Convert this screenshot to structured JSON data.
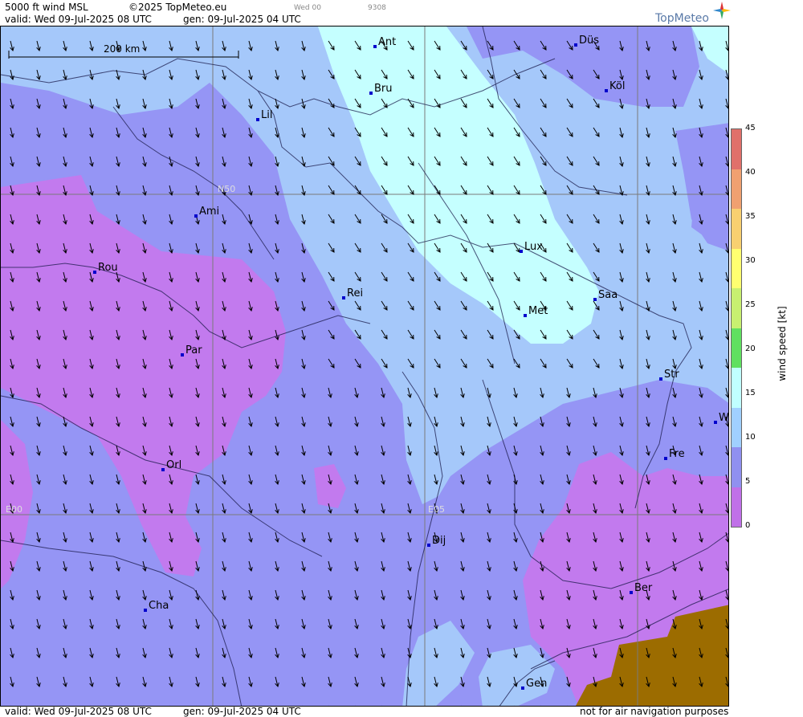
{
  "header": {
    "product": "5000 ft wind MSL",
    "copyright": "©2025 TopMeteo.eu",
    "small_a": "Wed 00",
    "small_b": "9308",
    "valid": "valid:  Wed  09-Jul-2025  08 UTC",
    "gen": "gen: 09-Jul-2025 04 UTC",
    "brand": "TopMeteo"
  },
  "footer": {
    "valid": "valid:  Wed  09-Jul-2025  08 UTC",
    "gen": "gen: 09-Jul-2025 04 UTC",
    "disclaimer": "not for air navigation purposes"
  },
  "map": {
    "scale_label": "200 km",
    "grid_labels": {
      "lat": "N50",
      "lon0": "E00",
      "lon5": "E05"
    },
    "cities": [
      {
        "name": "Ant"
      },
      {
        "name": "Düs"
      },
      {
        "name": "Bru"
      },
      {
        "name": "Köl"
      },
      {
        "name": "Lil"
      },
      {
        "name": "Ami"
      },
      {
        "name": "Rou"
      },
      {
        "name": "Lux"
      },
      {
        "name": "Rei"
      },
      {
        "name": "Saa"
      },
      {
        "name": "Met"
      },
      {
        "name": "Par"
      },
      {
        "name": "Str"
      },
      {
        "name": "W"
      },
      {
        "name": "Fre"
      },
      {
        "name": "Orl"
      },
      {
        "name": "Dij"
      },
      {
        "name": "Ber"
      },
      {
        "name": "Cha"
      },
      {
        "name": "Gen"
      }
    ]
  },
  "legend": {
    "label": "wind speed [kt]",
    "ticks": [
      "45",
      "40",
      "35",
      "30",
      "25",
      "20",
      "15",
      "10",
      "5",
      "0"
    ],
    "colors": [
      "#e0706a",
      "#f0a070",
      "#f8d070",
      "#ffff70",
      "#c8f070",
      "#60e060",
      "#c0ffff",
      "#a0d0ff",
      "#9090f0",
      "#c070e8"
    ]
  }
}
